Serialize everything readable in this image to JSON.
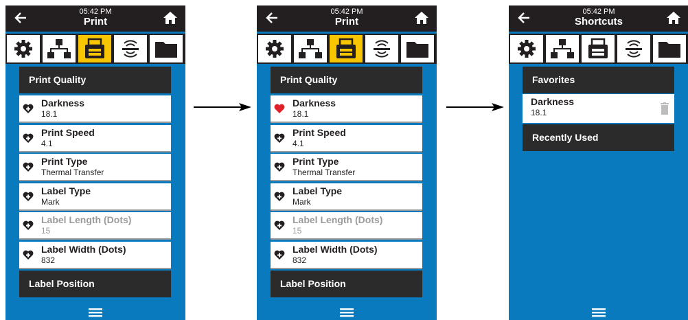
{
  "screens": [
    {
      "time": "05:42 PM",
      "title": "Print",
      "active_tab": 2,
      "section1": "Print Quality",
      "items": [
        {
          "name": "Darkness",
          "value": "18.1",
          "fav": false,
          "dim": false
        },
        {
          "name": "Print Speed",
          "value": "4.1",
          "fav": false,
          "dim": false
        },
        {
          "name": "Print Type",
          "value": "Thermal Transfer",
          "fav": false,
          "dim": false
        },
        {
          "name": "Label Type",
          "value": "Mark",
          "fav": false,
          "dim": false
        },
        {
          "name": "Label Length (Dots)",
          "value": "15",
          "fav": false,
          "dim": true
        },
        {
          "name": "Label Width (Dots)",
          "value": "832",
          "fav": false,
          "dim": false
        }
      ],
      "section2": "Label Position"
    },
    {
      "time": "05:42 PM",
      "title": "Print",
      "active_tab": 2,
      "section1": "Print Quality",
      "items": [
        {
          "name": "Darkness",
          "value": "18.1",
          "fav": true,
          "dim": false
        },
        {
          "name": "Print Speed",
          "value": "4.1",
          "fav": false,
          "dim": false
        },
        {
          "name": "Print Type",
          "value": "Thermal Transfer",
          "fav": false,
          "dim": false
        },
        {
          "name": "Label Type",
          "value": "Mark",
          "fav": false,
          "dim": false
        },
        {
          "name": "Label Length (Dots)",
          "value": "15",
          "fav": false,
          "dim": true
        },
        {
          "name": "Label Width (Dots)",
          "value": "832",
          "fav": false,
          "dim": false
        }
      ],
      "section2": "Label Position"
    },
    {
      "time": "05:42 PM",
      "title": "Shortcuts",
      "active_tab": -1,
      "favorites_label": "Favorites",
      "favorite_item": {
        "name": "Darkness",
        "value": "18.1"
      },
      "recent_label": "Recently Used"
    }
  ],
  "icons": [
    "settings-icon",
    "network-icon",
    "print-icon",
    "rfid-icon",
    "storage-icon"
  ],
  "colors": {
    "background": "#0a7abf",
    "bar": "#231f20",
    "active_tab": "#f7c600",
    "favorite": "#e0202a"
  }
}
